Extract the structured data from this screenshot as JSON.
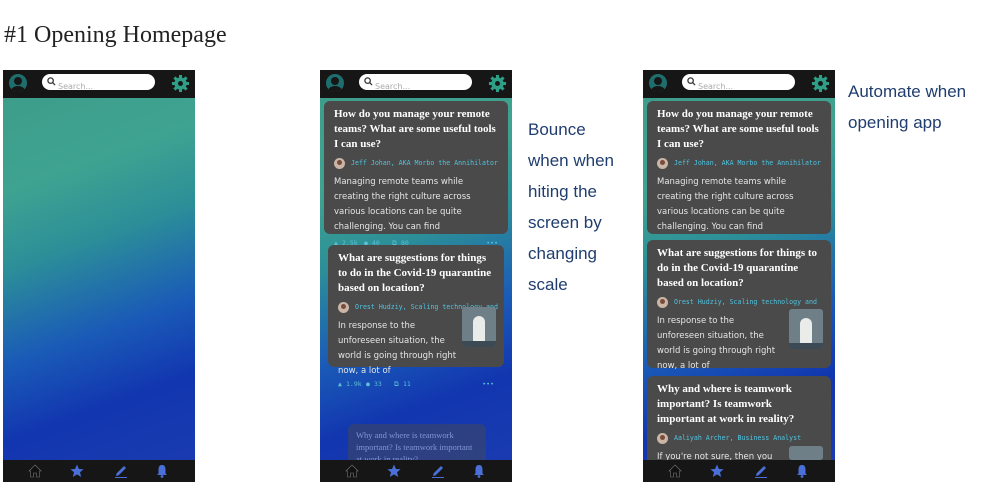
{
  "page_title": "#1 Opening Homepage",
  "search_placeholder": "Search...",
  "notes": {
    "bounce": [
      "Bounce",
      "when when",
      "hiting the",
      "screen by",
      "changing",
      "scale"
    ],
    "automate": [
      "Automate when",
      "opening app"
    ]
  },
  "cards": [
    {
      "question": "How do you manage your remote teams? What are some useful tools I can use?",
      "author": "Jeff Johan, AKA Morbo the Annihilator",
      "snippet": "Managing remote teams while creating the right culture across various locations can be quite challenging. You can find",
      "upvotes": "2.5k",
      "comments": "40",
      "shares": "80",
      "more": "•••"
    },
    {
      "question": "What are suggestions for things to do in the Covid-19 quarantine based on location?",
      "author": "Orest Hudziy, Scaling technology and",
      "snippet": "In response to the unforeseen situation, the world is going through right now, a lot of",
      "upvotes": "1.9k",
      "comments": "33",
      "shares": "11",
      "more": "•••"
    },
    {
      "question": "Why and where is teamwork important? Is teamwork important at work in reality?",
      "author": "Aaliyah Archer, Business Analyst",
      "snippet": "If you're not sure, then you",
      "upvotes": "",
      "comments": "",
      "shares": "",
      "more": ""
    }
  ],
  "colors": {
    "accent_teal": "#2f9e86",
    "nav_blue": "#4a6fd8",
    "bar_dark": "#161616",
    "card_grey": "#4a4a4a"
  },
  "icons": [
    "user-avatar-icon",
    "search-icon",
    "gear-icon",
    "home-icon",
    "star-icon",
    "pencil-icon",
    "bell-icon",
    "upvote-icon",
    "comment-icon",
    "share-icon"
  ]
}
